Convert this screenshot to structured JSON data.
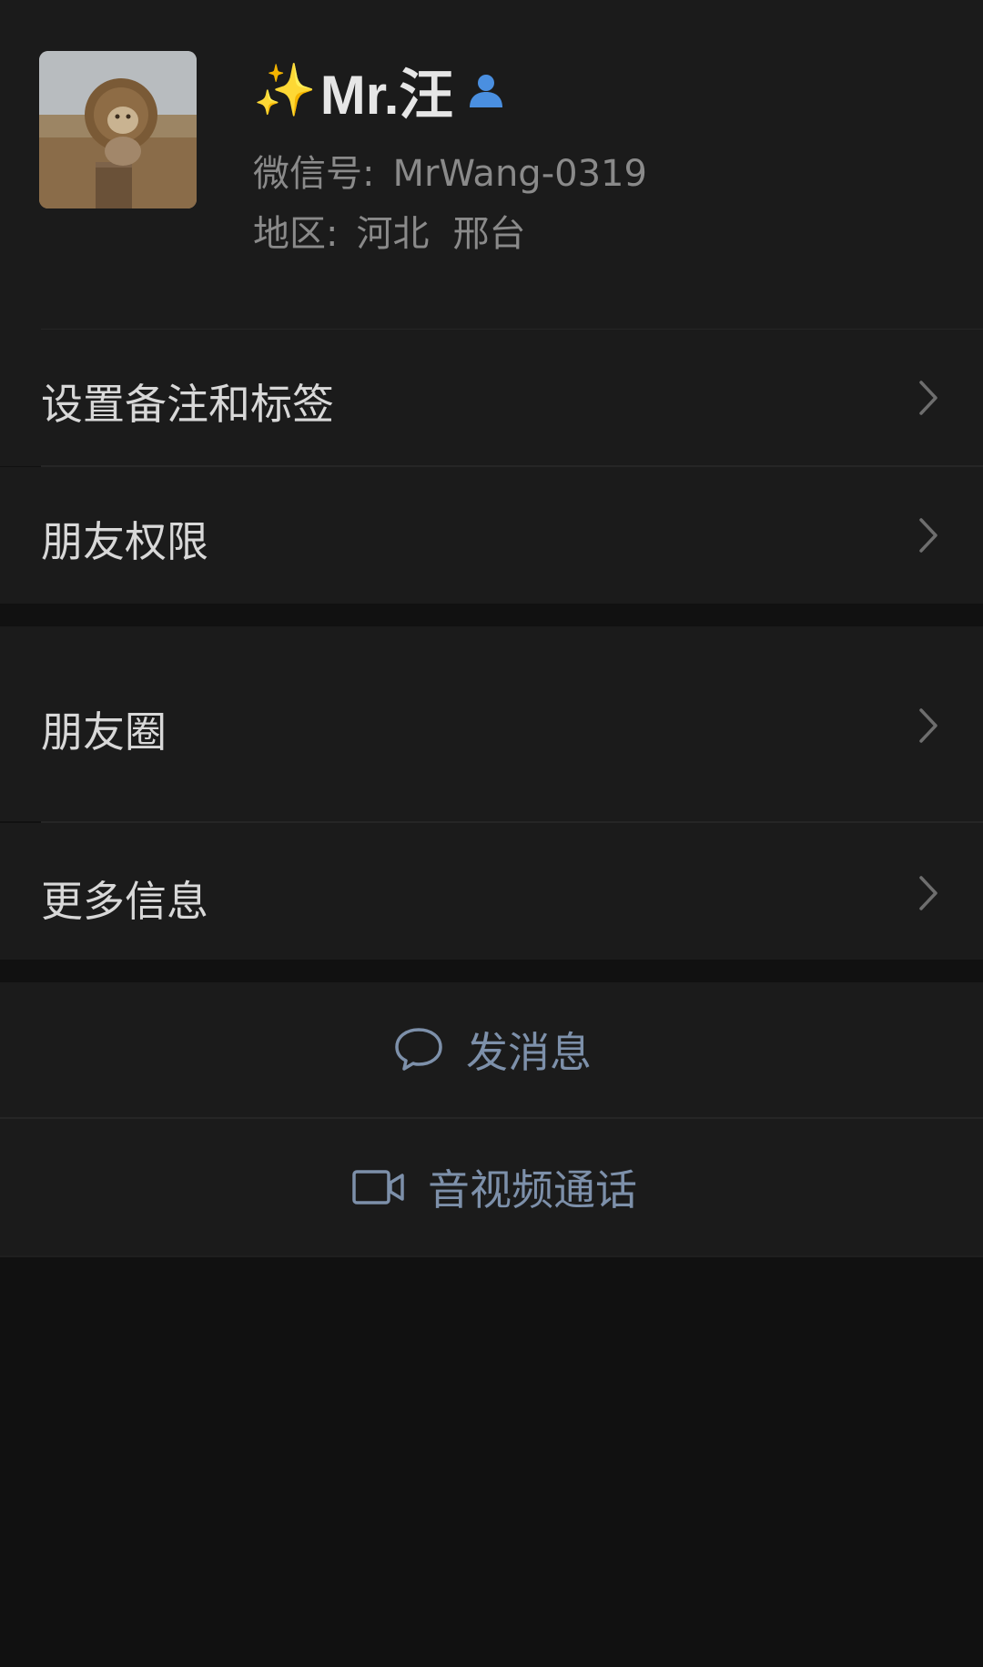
{
  "profile": {
    "sparkle": "✨",
    "name": "Mr.汪",
    "wechat_id_label": "微信号:",
    "wechat_id": "MrWang-0319",
    "region_label": "地区:",
    "region_province": "河北",
    "region_city": "邢台"
  },
  "menu": {
    "remark_tags": "设置备注和标签",
    "friend_permissions": "朋友权限",
    "moments": "朋友圈",
    "more_info": "更多信息"
  },
  "actions": {
    "send_message": "发消息",
    "av_call": "音视频通话"
  },
  "colors": {
    "background": "#111111",
    "cell": "#1b1b1b",
    "action_text": "#7d90aa",
    "contact_icon": "#4a8fe0"
  },
  "icons": {
    "contact": "person-icon",
    "chevron": "chevron-right-icon",
    "message": "chat-bubble-icon",
    "video": "video-camera-icon"
  }
}
